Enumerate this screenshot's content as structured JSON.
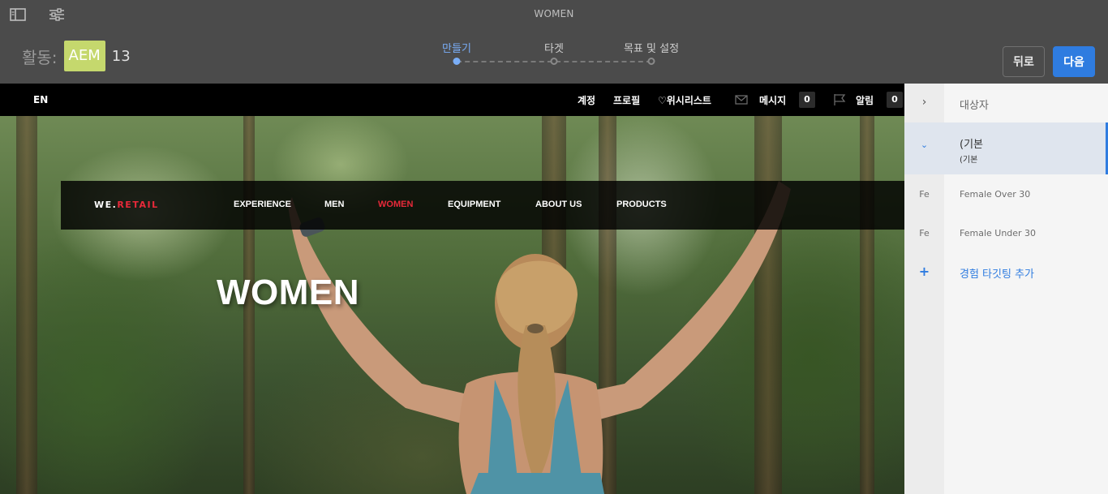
{
  "window": {
    "title": "WOMEN"
  },
  "toolbar": {
    "panel_toggle_icon": "side-panel-icon",
    "properties_icon": "sliders-icon"
  },
  "activity": {
    "label": "활동:",
    "chip": "AEM",
    "count": "13"
  },
  "wizard": {
    "steps": [
      {
        "label": "만들기",
        "active": true
      },
      {
        "label": "타겟",
        "active": false
      },
      {
        "label": "목표 및 설정",
        "active": false
      }
    ]
  },
  "buttons": {
    "back": "뒤로",
    "next": "다음"
  },
  "site": {
    "lang": "EN",
    "topnav": {
      "account": "계정",
      "profile": "프로필",
      "wishlist": "♡위시리스트",
      "messages": "메시지",
      "messages_count": "0",
      "alerts": "알림",
      "alerts_count": "0"
    },
    "brand": {
      "prefix": "WE.",
      "accent": "RETAIL"
    },
    "mainnav": [
      "EXPERIENCE",
      "MEN",
      "WOMEN",
      "EQUIPMENT",
      "ABOUT US",
      "PRODUCTS"
    ],
    "active_nav": "WOMEN",
    "hero_title": "WOMEN"
  },
  "panel": {
    "header": "대상자",
    "default": {
      "title": "(기본",
      "subtitle": "(기본"
    },
    "audiences": [
      {
        "abbr": "Fe",
        "label": "Female Over 30"
      },
      {
        "abbr": "Fe",
        "label": "Female Under 30"
      }
    ],
    "add_label": "경험 타깃팅 추가"
  },
  "colors": {
    "accent": "#2f7ce0",
    "brand_red": "#e8293a",
    "chip": "#c5d86d"
  }
}
